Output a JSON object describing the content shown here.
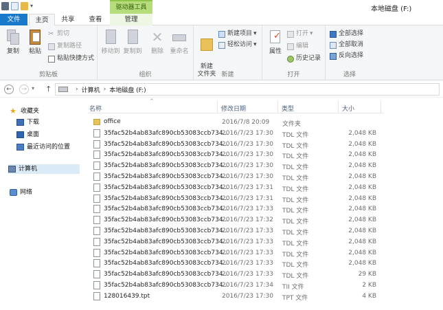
{
  "window": {
    "title": "本地磁盘 (F:)",
    "context_tab_title": "驱动器工具"
  },
  "tabs": {
    "file": "文件",
    "home": "主页",
    "share": "共享",
    "view": "查看",
    "manage": "管理"
  },
  "ribbon": {
    "clipboard": {
      "label": "剪贴板",
      "copy": "复制",
      "paste": "粘贴",
      "cut": "剪切",
      "copy_path": "复制路径",
      "paste_shortcut": "粘贴快捷方式"
    },
    "organize": {
      "label": "组织",
      "move_to": "移动到",
      "copy_to": "复制到",
      "delete": "删除",
      "rename": "重命名"
    },
    "new": {
      "label": "新建",
      "new_folder": "新建\n文件夹",
      "new_item": "新建项目",
      "easy_access": "轻松访问"
    },
    "open": {
      "label": "打开",
      "properties": "属性",
      "open": "打开",
      "edit": "编辑",
      "history": "历史记录"
    },
    "select": {
      "label": "选择",
      "select_all": "全部选择",
      "select_none": "全部取消",
      "invert": "反向选择"
    }
  },
  "address": {
    "parts": [
      "计算机",
      "本地磁盘 (F:)"
    ]
  },
  "nav": {
    "favorites": "收藏夹",
    "downloads": "下载",
    "desktop": "桌面",
    "recent": "最近访问的位置",
    "computer": "计算机",
    "network": "网络"
  },
  "columns": {
    "name": "名称",
    "date": "修改日期",
    "type": "类型",
    "size": "大小"
  },
  "files": [
    {
      "name": "office",
      "date": "2016/7/8 20:09",
      "type": "文件夹",
      "size": "",
      "icon": "folder-icon"
    },
    {
      "name": "35fac52b4ab83afc890cb53083ccb734...",
      "date": "2016/7/23 17:30",
      "type": "TDL 文件",
      "size": "2,048 KB",
      "icon": "file-icon"
    },
    {
      "name": "35fac52b4ab83afc890cb53083ccb734...",
      "date": "2016/7/23 17:30",
      "type": "TDL 文件",
      "size": "2,048 KB",
      "icon": "file-icon"
    },
    {
      "name": "35fac52b4ab83afc890cb53083ccb734...",
      "date": "2016/7/23 17:30",
      "type": "TDL 文件",
      "size": "2,048 KB",
      "icon": "file-icon"
    },
    {
      "name": "35fac52b4ab83afc890cb53083ccb734...",
      "date": "2016/7/23 17:30",
      "type": "TDL 文件",
      "size": "2,048 KB",
      "icon": "file-icon"
    },
    {
      "name": "35fac52b4ab83afc890cb53083ccb734...",
      "date": "2016/7/23 17:30",
      "type": "TDL 文件",
      "size": "2,048 KB",
      "icon": "file-icon"
    },
    {
      "name": "35fac52b4ab83afc890cb53083ccb734...",
      "date": "2016/7/23 17:31",
      "type": "TDL 文件",
      "size": "2,048 KB",
      "icon": "file-icon"
    },
    {
      "name": "35fac52b4ab83afc890cb53083ccb734...",
      "date": "2016/7/23 17:31",
      "type": "TDL 文件",
      "size": "2,048 KB",
      "icon": "file-icon"
    },
    {
      "name": "35fac52b4ab83afc890cb53083ccb734...",
      "date": "2016/7/23 17:33",
      "type": "TDL 文件",
      "size": "2,048 KB",
      "icon": "file-icon"
    },
    {
      "name": "35fac52b4ab83afc890cb53083ccb734...",
      "date": "2016/7/23 17:32",
      "type": "TDL 文件",
      "size": "2,048 KB",
      "icon": "file-icon"
    },
    {
      "name": "35fac52b4ab83afc890cb53083ccb734...",
      "date": "2016/7/23 17:33",
      "type": "TDL 文件",
      "size": "2,048 KB",
      "icon": "file-icon"
    },
    {
      "name": "35fac52b4ab83afc890cb53083ccb734...",
      "date": "2016/7/23 17:33",
      "type": "TDL 文件",
      "size": "2,048 KB",
      "icon": "file-icon"
    },
    {
      "name": "35fac52b4ab83afc890cb53083ccb734...",
      "date": "2016/7/23 17:33",
      "type": "TDL 文件",
      "size": "2,048 KB",
      "icon": "file-icon"
    },
    {
      "name": "35fac52b4ab83afc890cb53083ccb734...",
      "date": "2016/7/23 17:33",
      "type": "TDL 文件",
      "size": "2,048 KB",
      "icon": "file-icon"
    },
    {
      "name": "35fac52b4ab83afc890cb53083ccb734...",
      "date": "2016/7/23 17:33",
      "type": "TDL 文件",
      "size": "29 KB",
      "icon": "file-icon"
    },
    {
      "name": "35fac52b4ab83afc890cb53083ccb734...",
      "date": "2016/7/23 17:34",
      "type": "TII 文件",
      "size": "2 KB",
      "icon": "file-icon"
    },
    {
      "name": "128016439.tpt",
      "date": "2016/7/23 17:30",
      "type": "TPT 文件",
      "size": "4 KB",
      "icon": "file-icon"
    }
  ]
}
